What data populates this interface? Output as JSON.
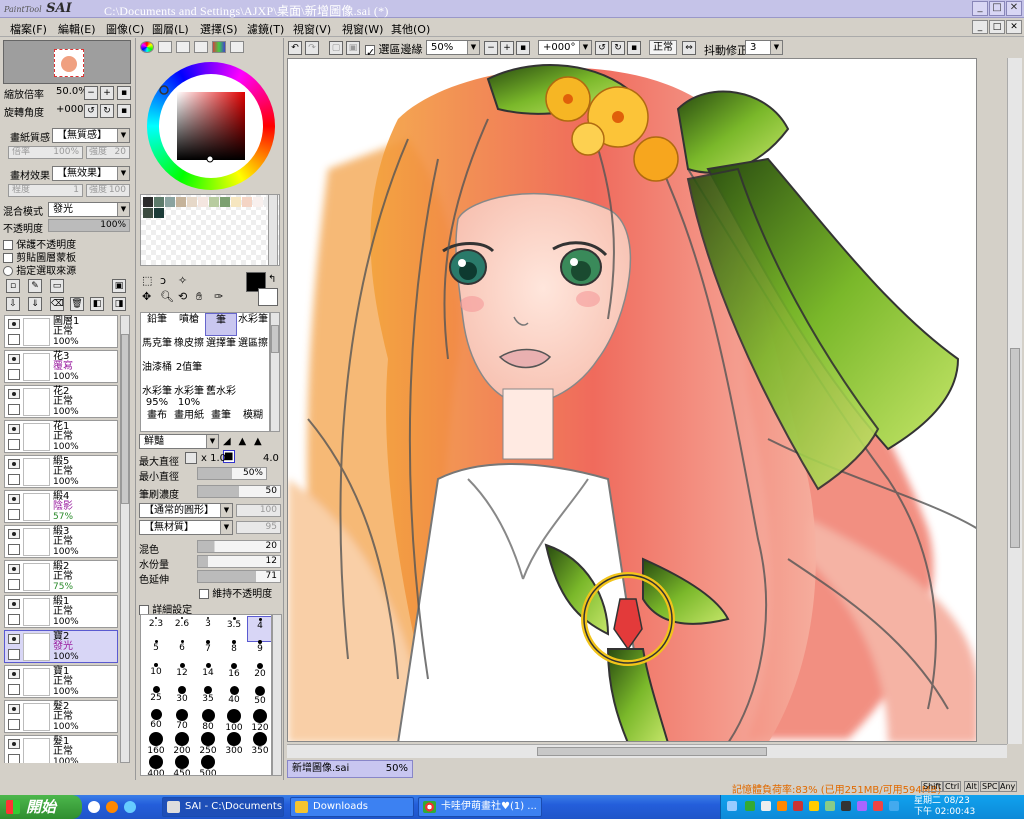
{
  "window": {
    "app_logo": "SAI",
    "app_logo_small": "PaintTool",
    "title": "C:\\Documents and Settings\\AJXP\\桌面\\新增圖像.sai (*)"
  },
  "menu": [
    "檔案(F)",
    "編輯(E)",
    "圖像(C)",
    "圖層(L)",
    "選擇(S)",
    "濾鏡(T)",
    "視窗(V)",
    "視窗(W)",
    "其他(O)"
  ],
  "navigator": {
    "zoom_label": "縮放倍率",
    "zoom_value": "50.0%",
    "rotate_label": "旋轉角度",
    "rotate_value": "+000"
  },
  "paper": {
    "texture_label": "畫紙質感",
    "texture_value": "【無質感】",
    "tex_scale_label": "倍率",
    "tex_scale_value": "100%",
    "tex_strength_label": "強度",
    "tex_strength_value": "20",
    "effect_label": "畫材效果",
    "effect_value": "【無效果】",
    "eff_degree_label": "程度",
    "eff_degree_value": "1",
    "eff_strength_label": "強度",
    "eff_strength_value": "100"
  },
  "layer_props": {
    "blend_label": "混合模式",
    "blend_value": "發光",
    "opacity_label": "不透明度",
    "opacity_value": "100%",
    "opacity_fraction": 1.0,
    "preserve_label": "保護不透明度",
    "clip_label": "剪貼圖層蒙板",
    "source_label": "指定選取來源"
  },
  "layers": [
    {
      "name": "圖層1",
      "mode": "正常",
      "opacity": "100%",
      "selected": false
    },
    {
      "name": "花3",
      "mode": "覆寫",
      "opacity": "100%",
      "selected": false
    },
    {
      "name": "花2",
      "mode": "正常",
      "opacity": "100%",
      "selected": false
    },
    {
      "name": "花1",
      "mode": "正常",
      "opacity": "100%",
      "selected": false
    },
    {
      "name": "緞5",
      "mode": "正常",
      "opacity": "100%",
      "selected": false
    },
    {
      "name": "緞4",
      "mode": "陰影",
      "opacity": "57%",
      "selected": false
    },
    {
      "name": "緞3",
      "mode": "正常",
      "opacity": "100%",
      "selected": false
    },
    {
      "name": "緞2",
      "mode": "正常",
      "opacity": "75%",
      "selected": false
    },
    {
      "name": "緞1",
      "mode": "正常",
      "opacity": "100%",
      "selected": false
    },
    {
      "name": "寶2",
      "mode": "發光",
      "opacity": "100%",
      "selected": true
    },
    {
      "name": "寶1",
      "mode": "正常",
      "opacity": "100%",
      "selected": false
    },
    {
      "name": "髮2",
      "mode": "正常",
      "opacity": "100%",
      "selected": false
    },
    {
      "name": "髮1",
      "mode": "正常",
      "opacity": "100%",
      "selected": false
    }
  ],
  "colors": {
    "primary": "#000000",
    "secondary": "#ffffff",
    "palette": [
      "#2b2b2b",
      "#5c7a6a",
      "#8aa3a0",
      "#c5b39a",
      "#e6d8c8",
      "#f4e6e0",
      "#b8cca0",
      "#7ca070",
      "#f6e6c0",
      "#f4d4c4",
      "#f8f0ee",
      "#ececec",
      "#3c4c40",
      "#1c3c38"
    ]
  },
  "tools": [
    "鉛筆",
    "噴槍",
    "筆",
    "水彩筆",
    "馬克筆",
    "橡皮擦",
    "選擇筆",
    "選區擦",
    "油漆桶",
    "2值筆",
    "",
    "",
    "水彩筆 95%",
    "水彩筆 10%",
    "舊水彩",
    "",
    "畫布",
    "畫用紙",
    "畫筆",
    "模糊"
  ],
  "brush": {
    "shape_value": "鮮豔",
    "max_size_label": "最大直徑",
    "max_size_mult": "x 1.0",
    "max_size_value": "4.0",
    "min_size_label": "最小直徑",
    "min_size_value": "50%",
    "min_size_fraction": 0.5,
    "density_label": "筆刷濃度",
    "density_value": "50",
    "density_fraction": 0.5,
    "shape_combo": "【通常的圓形】",
    "shape_strength": "100",
    "texture_combo": "【無材質】",
    "texture_strength": "95",
    "blend_label": "混色",
    "blend_value": "20",
    "blend_fraction": 0.2,
    "water_label": "水份量",
    "water_value": "12",
    "water_fraction": 0.12,
    "persist_label": "色延伸",
    "persist_value": "71",
    "persist_fraction": 0.71,
    "keep_opacity_label": "維持不透明度",
    "detail_label": "詳細設定"
  },
  "brush_sizes": [
    "2.3",
    "2.6",
    "3",
    "3.5",
    "4",
    "5",
    "6",
    "7",
    "8",
    "9",
    "10",
    "12",
    "14",
    "16",
    "20",
    "25",
    "30",
    "35",
    "40",
    "50",
    "60",
    "70",
    "80",
    "100",
    "120",
    "160",
    "200",
    "250",
    "300",
    "350",
    "400",
    "450",
    "500"
  ],
  "canvas_toolbar": {
    "selection_edge_label": "選區邊緣",
    "zoom_value": "50%",
    "rotate_value": "+000°",
    "mode_value": "正常",
    "stabilizer_label": "抖動修正",
    "stabilizer_value": "3"
  },
  "doc_tab": {
    "name": "新增圖像.sai",
    "zoom": "50%"
  },
  "status": {
    "memory": "記憶體負荷率:83% (已用251MB/可用594MB)",
    "keys": [
      "Shift",
      "Ctrl",
      "Alt",
      "SPC",
      "Any"
    ]
  },
  "taskbar": {
    "start": "開始",
    "tasks": [
      "SAI - C:\\Documents a...",
      "Downloads",
      "卡哇伊萌畫社♥(1) ..."
    ],
    "clock_day": "星期二 08/23",
    "clock_time": "下午 02:00:43"
  }
}
